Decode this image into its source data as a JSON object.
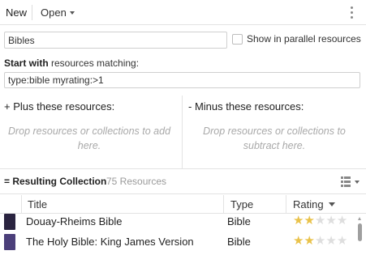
{
  "toolbar": {
    "new_label": "New",
    "open_label": "Open"
  },
  "collection": {
    "name_value": "Bibles",
    "parallel_label": "Show in parallel resources",
    "parallel_checked": false,
    "start_bold": "Start with",
    "start_rest": " resources matching:",
    "query_value": "type:bible myrating:>1"
  },
  "plus": {
    "title": "+  Plus these resources:",
    "hint": "Drop resources or collections to add here."
  },
  "minus": {
    "title": "-  Minus these resources:",
    "hint": "Drop resources or collections to subtract here."
  },
  "results": {
    "title": "= Resulting Collection",
    "count": "75 Resources",
    "columns": {
      "title": "Title",
      "type": "Type",
      "rating": "Rating"
    },
    "rows": [
      {
        "title": "Douay-Rheims Bible",
        "type": "Bible",
        "rating": 2,
        "max_rating": 5,
        "cover_color": "#2a2440"
      },
      {
        "title": "The Holy Bible: King James Version",
        "type": "Bible",
        "rating": 2,
        "max_rating": 5,
        "cover_color": "#4b3f7a"
      }
    ]
  },
  "icons": {
    "more": "more-vertical-icon",
    "view": "list-view-icon",
    "sort": "chevron-down-icon"
  }
}
